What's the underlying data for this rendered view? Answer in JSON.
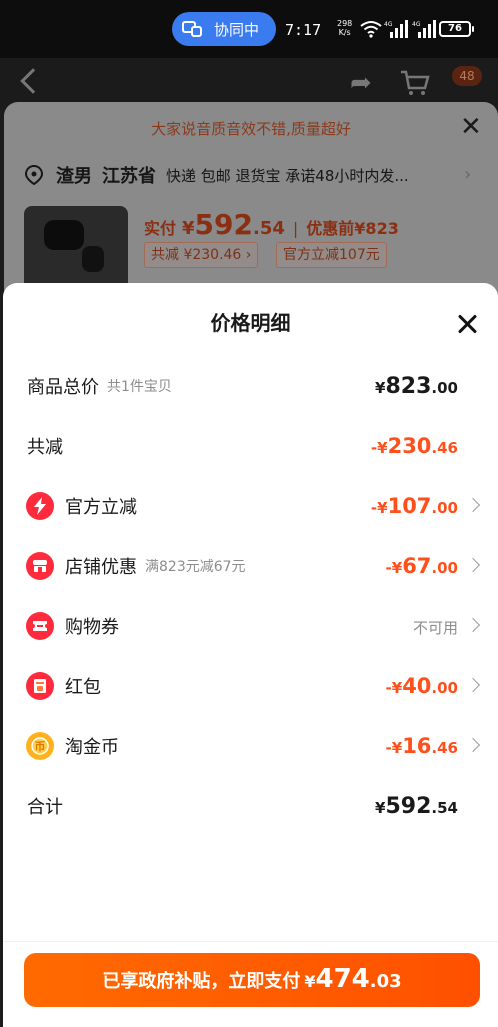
{
  "status_bar": {
    "collab_label": "协同中",
    "time": "7:17",
    "net_speed_value": "298",
    "net_speed_unit": "K/s",
    "battery": "76",
    "signal_label": "4G"
  },
  "app_header": {
    "cart_badge": "48"
  },
  "background_sheet": {
    "promo": "大家说音质音效不错,质量超好",
    "address_name": "渣男",
    "address_region": "江苏省",
    "services": "快递 包邮 退货宝 承诺48小时内发...",
    "actual_label": "实付",
    "currency": "¥",
    "actual_int": "592",
    "actual_dec": ".54",
    "before_label": "优惠前",
    "before_value": "¥823",
    "tag_total_discount": "共减 ¥230.46",
    "tag_official": "官方立减107元"
  },
  "price_detail": {
    "title": "价格明细",
    "rows": [
      {
        "label": "商品总价",
        "sub": "共1件宝贝",
        "sign": "",
        "currency": "¥",
        "int": "823",
        "dec": ".00"
      },
      {
        "label": "共减",
        "sub": "",
        "sign": "-",
        "currency": "¥",
        "int": "230",
        "dec": ".46"
      },
      {
        "label": "官方立减",
        "sub": "",
        "sign": "-",
        "currency": "¥",
        "int": "107",
        "dec": ".00"
      },
      {
        "label": "店铺优惠",
        "sub": "满823元减67元",
        "sign": "-",
        "currency": "¥",
        "int": "67",
        "dec": ".00"
      },
      {
        "label": "购物券",
        "sub": "",
        "status": "不可用"
      },
      {
        "label": "红包",
        "sub": "",
        "sign": "-",
        "currency": "¥",
        "int": "40",
        "dec": ".00"
      },
      {
        "label": "淘金币",
        "sub": "",
        "sign": "-",
        "currency": "¥",
        "int": "16",
        "dec": ".46"
      },
      {
        "label": "合计",
        "sub": "",
        "sign": "",
        "currency": "¥",
        "int": "592",
        "dec": ".54"
      }
    ]
  },
  "pay_button": {
    "text": "已享政府补贴，立即支付",
    "currency": "¥",
    "int": "474",
    "dec": ".03"
  },
  "colors": {
    "accent": "#ff5000",
    "discount_text": "#ff4f1a",
    "collab_pill": "#3a7cf0"
  },
  "icons": [
    "lightning-icon",
    "store-icon",
    "coupon-icon",
    "red-envelope-icon",
    "gold-coin-icon"
  ]
}
